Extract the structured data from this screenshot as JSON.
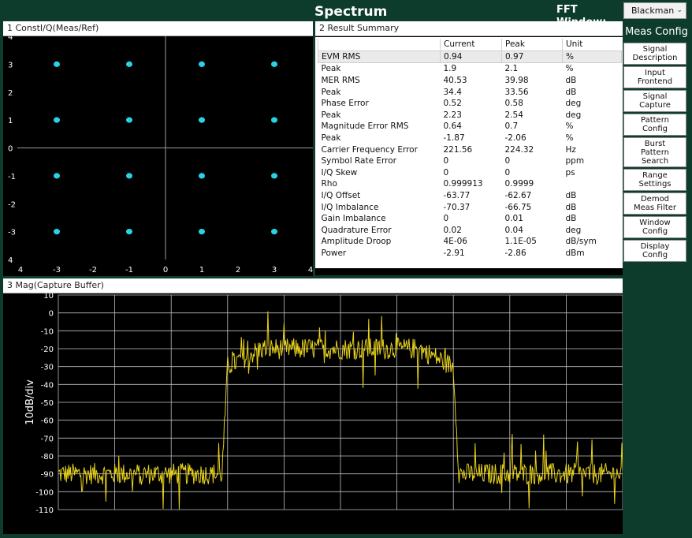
{
  "header": {
    "title": "Spectrum",
    "fft_window_label": "FFT Window:",
    "fft_window_value": "Blackman"
  },
  "panels": {
    "constellation": {
      "title": "1 ConstI/Q(Meas/Ref)"
    },
    "result_summary": {
      "title": "2 Result Summary"
    },
    "magnitude": {
      "title": "3 Mag(Capture Buffer)"
    }
  },
  "result_summary": {
    "columns": [
      "",
      "Current",
      "Peak",
      "Unit"
    ],
    "rows": [
      [
        "EVM RMS",
        "0.94",
        "0.97",
        "%"
      ],
      [
        "Peak",
        "1.9",
        "2.1",
        "%"
      ],
      [
        "MER RMS",
        "40.53",
        "39.98",
        "dB"
      ],
      [
        "Peak",
        "34.4",
        "33.56",
        "dB"
      ],
      [
        "Phase Error",
        "0.52",
        "0.58",
        "deg"
      ],
      [
        "Peak",
        "2.23",
        "2.54",
        "deg"
      ],
      [
        "Magnitude Error RMS",
        "0.64",
        "0.7",
        "%"
      ],
      [
        "Peak",
        "-1.87",
        "-2.06",
        "%"
      ],
      [
        "Carrier Frequency Error",
        "221.56",
        "224.32",
        "Hz"
      ],
      [
        "Symbol Rate Error",
        "0",
        "0",
        "ppm"
      ],
      [
        "I/Q Skew",
        "0",
        "0",
        "ps"
      ],
      [
        "Rho",
        "0.999913",
        "0.9999",
        ""
      ],
      [
        "I/Q Offset",
        "-63.77",
        "-62.67",
        "dB"
      ],
      [
        "I/Q Imbalance",
        "-70.37",
        "-66.75",
        "dB"
      ],
      [
        "Gain Imbalance",
        "0",
        "0.01",
        "dB"
      ],
      [
        "Quadrature Error",
        "0.02",
        "0.04",
        "deg"
      ],
      [
        "Amplitude Droop",
        "4E-06",
        "1.1E-05",
        "dB/sym"
      ],
      [
        "Power",
        "-2.91",
        "-2.86",
        "dBm"
      ]
    ]
  },
  "sidebar": {
    "title": "Meas Config",
    "buttons": [
      {
        "key": "signal-description",
        "label": "Signal\nDescription"
      },
      {
        "key": "input-frontend",
        "label": "Input\nFrontend"
      },
      {
        "key": "signal-capture",
        "label": "Signal\nCapture"
      },
      {
        "key": "pattern-config",
        "label": "Pattern\nConfig"
      },
      {
        "key": "burst-pattern-search",
        "label": "Burst\nPattern\nSearch"
      },
      {
        "key": "range-settings",
        "label": "Range\nSettings"
      },
      {
        "key": "demod-meas-filter",
        "label": "Demod\nMeas Filter"
      },
      {
        "key": "window-config",
        "label": "Window\nConfig"
      },
      {
        "key": "display-config",
        "label": "Display\nConfig"
      }
    ]
  },
  "colors": {
    "constellation_point": "#29d3e6",
    "trace": "#e8d21c",
    "grid": "#bfbfbf",
    "background": "#000000",
    "frame": "#0d3b2c"
  },
  "chart_data": [
    {
      "type": "scatter",
      "title": "1 ConstI/Q(Meas/Ref)",
      "xlim": [
        -4,
        4
      ],
      "ylim": [
        -4,
        4
      ],
      "x_ticks": [
        "4",
        "-3",
        "-2",
        "-1",
        "0",
        "1",
        "2",
        "3",
        "4"
      ],
      "y_ticks": [
        "4",
        "3",
        "2",
        "1",
        "0",
        "-1",
        "-2",
        "-3",
        "4"
      ],
      "points": [
        [
          -3,
          3
        ],
        [
          -1,
          3
        ],
        [
          1,
          3
        ],
        [
          3,
          3
        ],
        [
          -3,
          1
        ],
        [
          -1,
          1
        ],
        [
          1,
          1
        ],
        [
          3,
          1
        ],
        [
          -3,
          -1
        ],
        [
          -1,
          -1
        ],
        [
          1,
          -1
        ],
        [
          3,
          -1
        ],
        [
          -3,
          -3
        ],
        [
          -1,
          -3
        ],
        [
          1,
          -3
        ],
        [
          3,
          -3
        ]
      ]
    },
    {
      "type": "line",
      "title": "3 Mag(Capture Buffer)",
      "ylabel": "10dB/div",
      "ylim": [
        -110,
        10
      ],
      "y_ticks": [
        "10",
        "0",
        "-10",
        "-20",
        "-30",
        "-40",
        "-50",
        "-60",
        "-70",
        "-80",
        "-90",
        "-100",
        "-110"
      ],
      "x_range": [
        0,
        10
      ],
      "noise_floor_level": -90,
      "passband_level": -20,
      "passband_start": 3,
      "passband_end": 7,
      "shoulder_level": -30,
      "edge_width": 0.1
    }
  ]
}
